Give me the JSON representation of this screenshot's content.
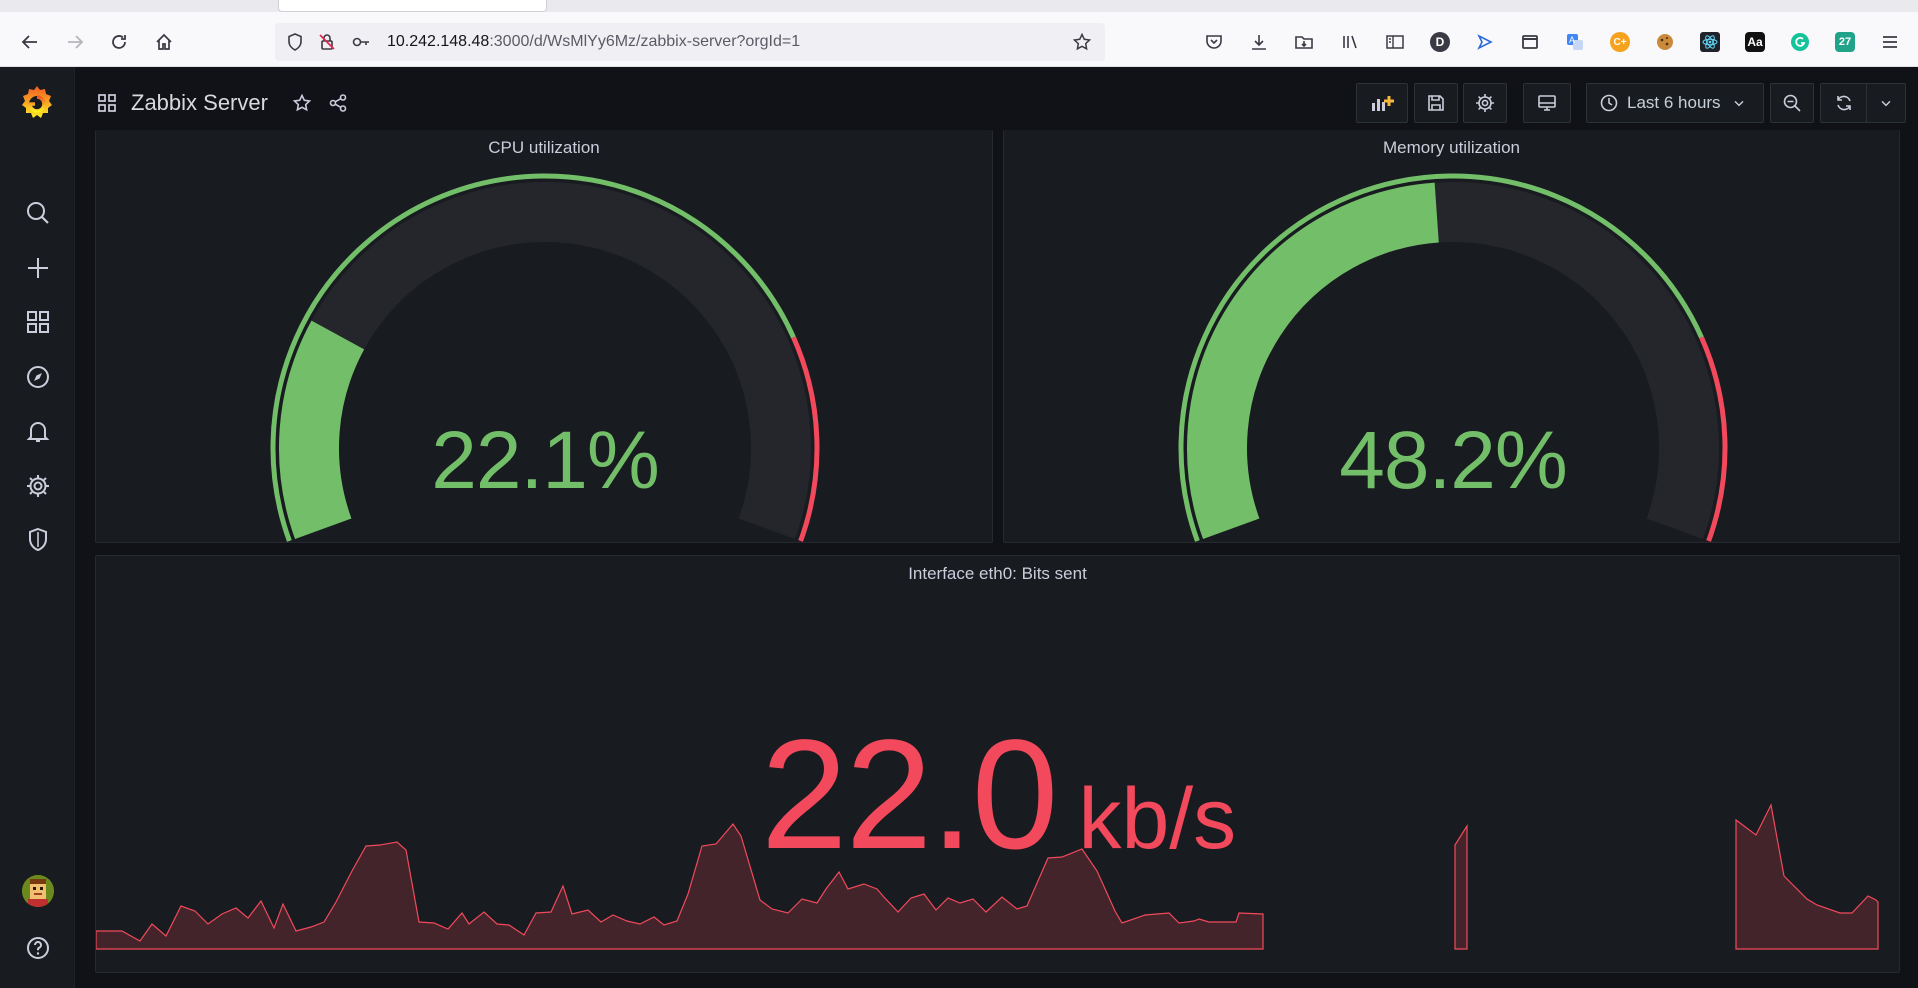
{
  "browser": {
    "url_host": "10.242.148.48",
    "url_path": ":3000/d/WsMlYy6Mz/zabbix-server?orgId=1",
    "toolbar_icons": [
      "pocket-icon",
      "download-icon",
      "extensions-folder-icon",
      "library-icon",
      "reader-view-icon",
      "d-extension-icon",
      "send-extension-icon",
      "window-icon",
      "translate-icon",
      "c-plus-extension-icon",
      "cookie-icon",
      "react-devtools-icon",
      "aa-extension-icon",
      "grammarly-icon",
      "27-extension-icon",
      "menu-icon"
    ],
    "badges": {
      "d": "D",
      "cplus": "C+",
      "aa": "Aa",
      "num": "27"
    }
  },
  "dashboard": {
    "title": "Zabbix Server",
    "time_range": "Last 6 hours"
  },
  "panels": {
    "cpu": {
      "title": "CPU utilization",
      "value": 22.1,
      "display": "22.1%",
      "color": "#73bf69"
    },
    "memory": {
      "title": "Memory utilization",
      "value": 48.2,
      "display": "48.2%",
      "color": "#73bf69"
    },
    "network": {
      "title": "Interface eth0: Bits sent",
      "value": "22.0",
      "unit": "kb/s",
      "color": "#f2495c"
    }
  },
  "colors": {
    "green": "#73bf69",
    "red": "#f2495c",
    "panel_bg": "#181b1f",
    "page_bg": "#111217"
  }
}
